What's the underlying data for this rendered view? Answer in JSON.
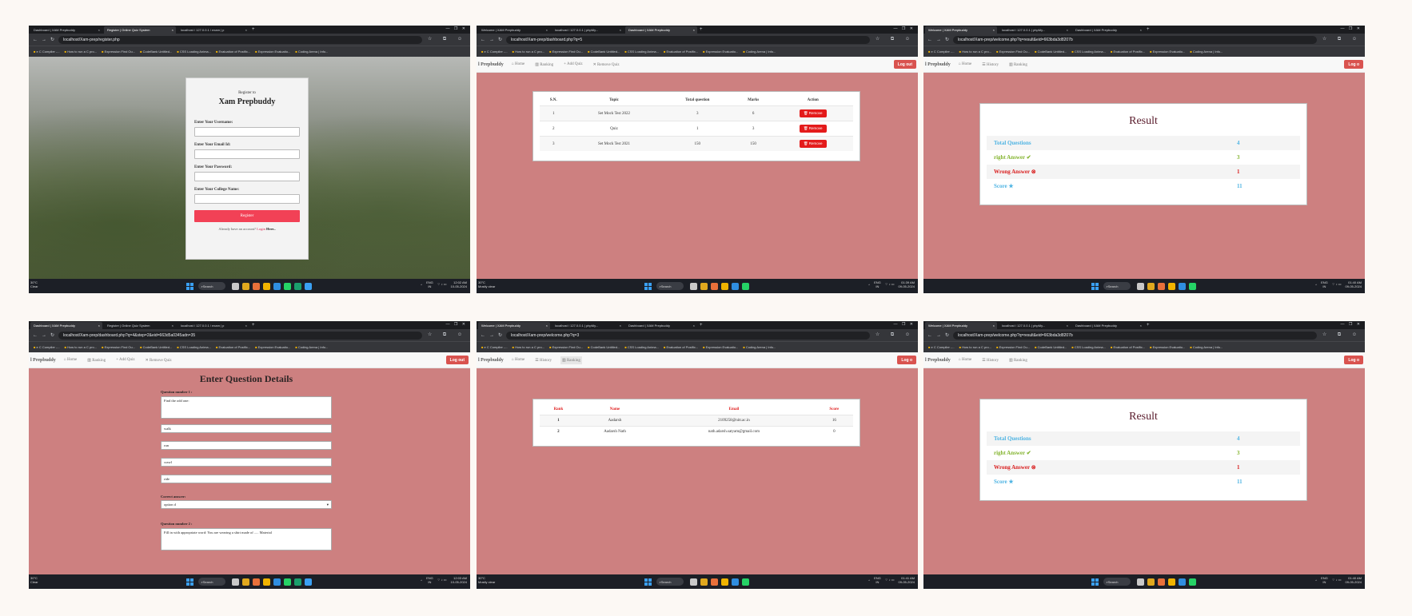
{
  "browser": {
    "bookmarks": [
      "e C Compiler -...",
      "How to run a C pro...",
      "Expression Find Ou...",
      "CodeBank Untitled...",
      "CSS Loading Anima...",
      "Evaluation of Postfix...",
      "Expression Evaluatio...",
      "Coding Arena | Info..."
    ],
    "all_bookmarks": "All Bookmarks"
  },
  "taskbar": {
    "search": "Search",
    "lang": "ENG",
    "region": "IN"
  },
  "shots": [
    {
      "tabs": [
        "Dashboard | XAM Prepbuddy",
        "Register | Online Quiz System",
        "localhost / 127.0.0.1 / exam | p"
      ],
      "active_tab": 1,
      "url": "localhost/Xam-prep/register.php",
      "weather": [
        "30°C",
        "Clear"
      ],
      "time": "12:02 AM",
      "date": "10-05-2024",
      "register": {
        "subtitle": "Register to",
        "title": "Xam Prepbuddy",
        "fields": [
          "Enter Your Username:",
          "Enter Your Email Id:",
          "Enter Your Password:",
          "Enter Your College Name:"
        ],
        "button": "Register",
        "footer_text": "Already have an account?",
        "footer_link1": "Login",
        "footer_link2": "Here.."
      }
    },
    {
      "tabs": [
        "Welcome | XAM Prepbuddy",
        "localhost / 127.0.0.1 | phpMy...",
        "Dashboard | XAM Prepbuddy"
      ],
      "active_tab": 2,
      "url": "localhost/Xam-prep/dashboard.php?q=5",
      "weather": [
        "30°C",
        "Mostly clear"
      ],
      "time": "01:39 AM",
      "date": "09-05-2024",
      "nav": {
        "brand": "l Prepbuddy",
        "items": [
          "Home",
          "Ranking",
          "Add Quiz",
          "Remove Quiz"
        ],
        "logout": "Log out"
      },
      "quiz_table": {
        "headers": [
          "S.N.",
          "Topic",
          "Total question",
          "Marks",
          "Action"
        ],
        "rows": [
          [
            "1",
            "Set Mock Test 2022",
            "3",
            "6",
            "Remove"
          ],
          [
            "2",
            "Quiz",
            "1",
            "3",
            "Remove"
          ],
          [
            "3",
            "Set Mock Test 2021",
            "150",
            "150",
            "Remove"
          ]
        ]
      }
    },
    {
      "tabs": [
        "Welcome | XAM Prepbuddy",
        "localhost / 127.0.0.1 | phpMy...",
        "Dashboard | XAM Prepbuddy"
      ],
      "active_tab": 0,
      "url": "localhost/Xam-prep/welcome.php?q=result&eid=663bda3d8207b",
      "weather": [],
      "time": "01:40 AM",
      "date": "09-05-2024",
      "nav": {
        "brand": "l Prepbuddy",
        "items": [
          "Home",
          "History",
          "Ranking"
        ],
        "logout": "Log o"
      },
      "result": {
        "title": "Result",
        "rows": [
          [
            "Total Questions",
            "4"
          ],
          [
            "right Answer",
            "3"
          ],
          [
            "Wrong Answer",
            "1"
          ],
          [
            "Score",
            "11"
          ]
        ]
      }
    },
    {
      "tabs": [
        "Dashboard | XAM Prepbuddy",
        "Register | Online Quiz System",
        "localhost / 127.0.0.1 / exam | p"
      ],
      "active_tab": 0,
      "url": "localhost/Xam-prep/dashboard.php?q=4&step=2&eid=663d5a0345adn=35",
      "weather": [
        "30°C",
        "Clear"
      ],
      "time": "12:03 AM",
      "date": "10-05-2024",
      "nav": {
        "brand": "l Prepbuddy",
        "items": [
          "Home",
          "Ranking",
          "Add Quiz",
          "Remove Quiz"
        ],
        "logout": "Log out"
      },
      "question_form": {
        "heading": "Enter Question Details",
        "q1_label": "Question number 1 :",
        "q1_text": "Find the odd one:",
        "options": [
          "walk",
          "run",
          "crawl",
          "ride"
        ],
        "answer_label": "Correct answer:",
        "answer_value": "option d",
        "q2_label": "Question number 2 :",
        "q2_text": "Fill in with appropriate word: You are wearing a shirt made of ..... Material"
      }
    },
    {
      "tabs": [
        "Welcome | XAM Prepbuddy",
        "localhost / 127.0.0.1 | phpMy...",
        "Dashboard | XAM Prepbuddy"
      ],
      "active_tab": 0,
      "url": "localhost/Xam-prep/welcome.php?q=3",
      "weather": [
        "30°C",
        "Mostly clear"
      ],
      "time": "01:41 AM",
      "date": "09-05-2024",
      "nav": {
        "brand": "l Prepbuddy",
        "items": [
          "Home",
          "History",
          "Ranking"
        ],
        "logout": "Log o"
      },
      "ranking": {
        "headers": [
          "Rank",
          "Name",
          "Email",
          "Score"
        ],
        "rows": [
          [
            "1",
            "Aadarsh",
            "2109258@nitr.ac.in",
            "16"
          ],
          [
            "2",
            "Aadarsh Nath",
            "nath.adarsh.satyam@gmail.com",
            "0"
          ]
        ]
      }
    },
    {
      "tabs": [
        "Welcome | XAM Prepbuddy",
        "localhost / 127.0.0.1 | phpMy...",
        "Dashboard | XAM Prepbuddy"
      ],
      "active_tab": 0,
      "url": "localhost/Xam-prep/welcome.php?q=result&eid=663bda3d8207b",
      "weather": [],
      "time": "01:40 AM",
      "date": "09-05-2024",
      "nav": {
        "brand": "l Prepbuddy",
        "items": [
          "Home",
          "History",
          "Ranking"
        ],
        "logout": "Log o"
      },
      "result": {
        "title": "Result",
        "rows": [
          [
            "Total Questions",
            "4"
          ],
          [
            "right Answer",
            "3"
          ],
          [
            "Wrong Answer",
            "1"
          ],
          [
            "Score",
            "11"
          ]
        ]
      }
    }
  ]
}
